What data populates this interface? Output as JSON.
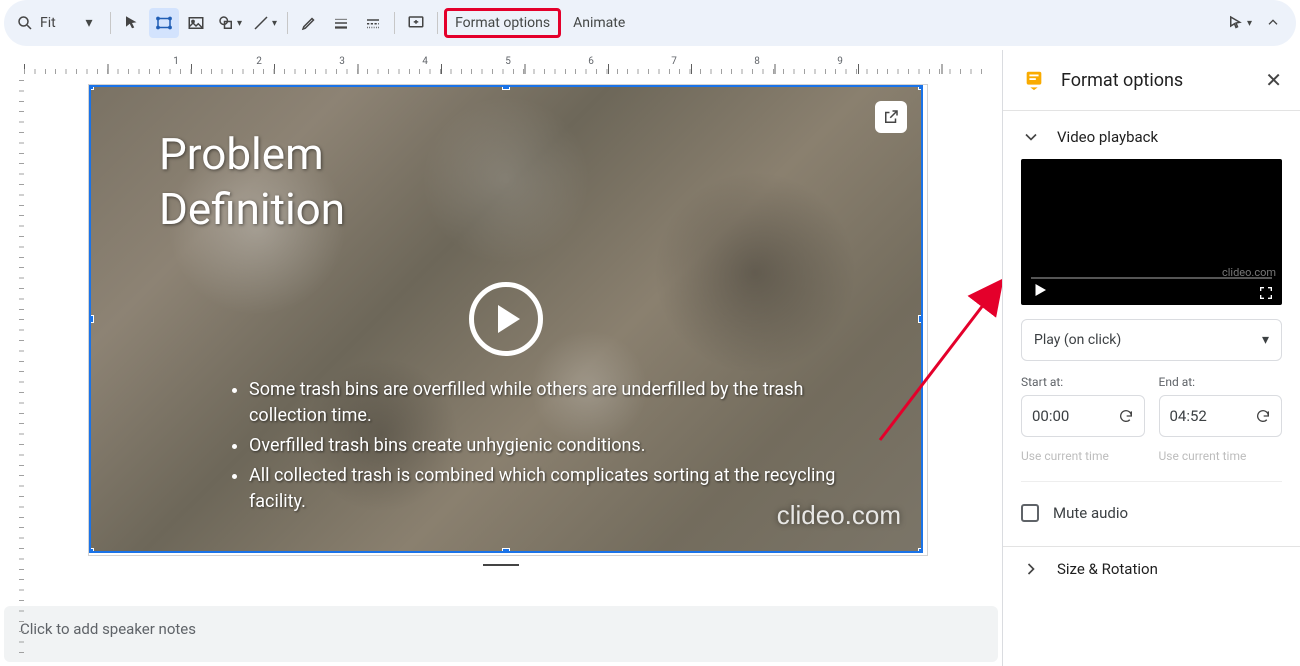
{
  "toolbar": {
    "zoom_label": "Fit",
    "format_options_label": "Format options",
    "animate_label": "Animate"
  },
  "ruler": {
    "numbers": [
      "1",
      "2",
      "3",
      "4",
      "5",
      "6",
      "7",
      "8",
      "9"
    ]
  },
  "slide": {
    "title_line1": "Problem",
    "title_line2": "Definition",
    "bullets": [
      "Some trash bins are overfilled while others are underfilled by the trash collection time.",
      "Overfilled trash bins create unhygienic conditions.",
      "All collected trash is combined which complicates sorting at the recycling facility."
    ],
    "watermark": "clideo.com"
  },
  "notes_placeholder": "Click to add speaker notes",
  "sidebar": {
    "title": "Format options",
    "section_video_playback": "Video playback",
    "preview_watermark": "clideo.com",
    "play_mode": "Play (on click)",
    "start_label": "Start at:",
    "start_value": "00:00",
    "end_label": "End at:",
    "end_value": "04:52",
    "use_current_time": "Use current time",
    "mute_audio": "Mute audio",
    "section_size_rotation": "Size & Rotation"
  }
}
